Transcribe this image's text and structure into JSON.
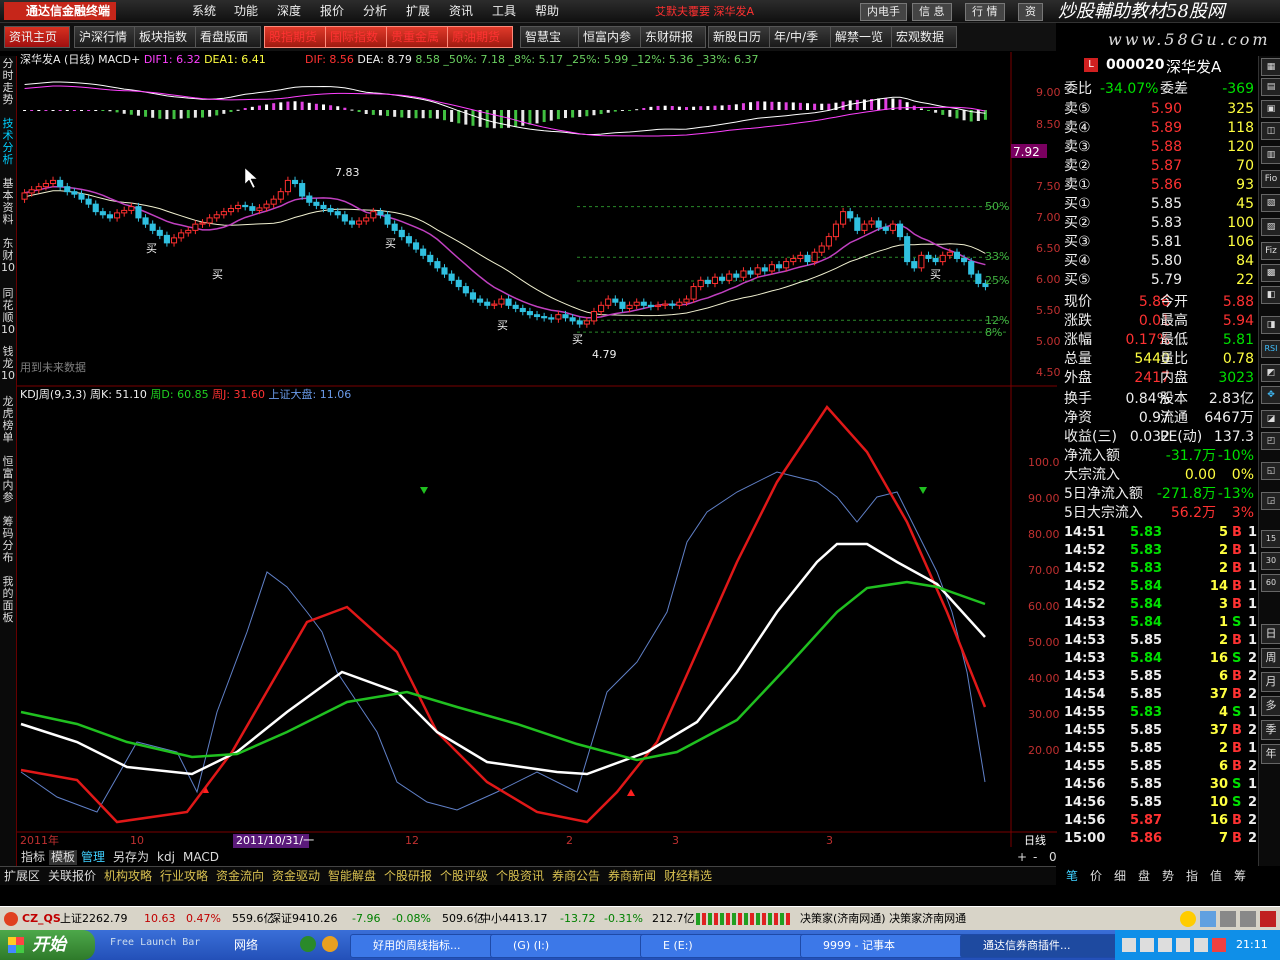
{
  "app": {
    "logo": "通达信金融终端",
    "menus": [
      "系统",
      "功能",
      "深度",
      "报价",
      "分析",
      "扩展",
      "资讯",
      "工具",
      "帮助"
    ],
    "alert": "艾默夫覆要 深华发A",
    "window_buttons": [
      "内电手",
      "信 息",
      "行 情",
      "资"
    ],
    "watermark": "炒股輔助教材58股网",
    "watermark_url": "www.58Gu.com"
  },
  "toolbar": {
    "buttons": [
      "资讯主页",
      "沪深行情",
      "板块指数",
      "看盘版面",
      "股指期货",
      "国际指数",
      "贵重金属",
      "原油期货",
      "智慧宝",
      "恒富内参",
      "东财研报",
      "新股日历",
      "年/中/季",
      "解禁一览",
      "宏观数据"
    ]
  },
  "left_tabs": [
    "分时走势",
    "技术分析",
    "基本资料",
    "东财10",
    "同花顺10",
    "钱龙10",
    "龙虎榜单",
    "恒富内参",
    "筹码分布",
    "我的面板"
  ],
  "upper_panel": {
    "stock": "深华发A",
    "period": "(日线)",
    "indicator": "MACD+",
    "dif1": "DIF1: 6.32",
    "dea1": "DEA1: 6.41",
    "dif": "DIF: 8.56",
    "dea": "DEA: 8.79",
    "pct_labels": "8.58  _50%: 7.18  _8%: 5.17  _25%: 5.99  _12%: 5.36  _33%: 6.37",
    "price_high": "7.83",
    "price_low": "4.79",
    "buy_label": "买",
    "cursor_price": "7.92",
    "y_ticks": [
      "9.00",
      "8.50",
      "8.00",
      "7.50",
      "7.00",
      "6.50",
      "6.00",
      "5.50",
      "5.00",
      "4.50"
    ],
    "fib_labels": [
      "50%",
      "33%",
      "25%",
      "12%",
      "8%"
    ],
    "note": "用到未来数据"
  },
  "lower_panel": {
    "indicator": "KDJ周(9,3,3)",
    "k": "周K: 51.10",
    "d": "周D: 60.85",
    "j": "周J: 31.60",
    "index": "上证大盘: 11.06",
    "y_ticks": [
      "100.0",
      "90.00",
      "80.00",
      "70.00",
      "60.00",
      "50.00",
      "40.00",
      "30.00",
      "20.00"
    ],
    "x_ticks": [
      "2011年",
      "10",
      "11",
      "12",
      "2",
      "3"
    ],
    "date_marker": "2011/10/31/一",
    "period_label": "日线"
  },
  "bottom_tabs": [
    "指标",
    "模板",
    "管理",
    "另存为",
    "kdj",
    "MACD"
  ],
  "quick_links": [
    "扩展区",
    "关联报价",
    "机构攻略",
    "行业攻略",
    "资金流向",
    "资金驱动",
    "智能解盘",
    "个股研报",
    "个股评级",
    "个股资讯",
    "券商公告",
    "券商新闻",
    "财经精选"
  ],
  "right_bottom_tabs": [
    "笔",
    "价",
    "细",
    "盘",
    "势",
    "指",
    "值",
    "筹"
  ],
  "quote": {
    "code": "000020",
    "name": "深华发A",
    "weibi_label": "委比",
    "weibi": "-34.07%",
    "weicha_label": "委差",
    "weicha": "-369",
    "asks": [
      {
        "label": "卖⑤",
        "price": "5.90",
        "vol": "325"
      },
      {
        "label": "卖④",
        "price": "5.89",
        "vol": "118"
      },
      {
        "label": "卖③",
        "price": "5.88",
        "vol": "120"
      },
      {
        "label": "卖②",
        "price": "5.87",
        "vol": "70"
      },
      {
        "label": "卖①",
        "price": "5.86",
        "vol": "93"
      }
    ],
    "bids": [
      {
        "label": "买①",
        "price": "5.85",
        "vol": "45"
      },
      {
        "label": "买②",
        "price": "5.83",
        "vol": "100"
      },
      {
        "label": "买③",
        "price": "5.81",
        "vol": "106"
      },
      {
        "label": "买④",
        "price": "5.80",
        "vol": "84"
      },
      {
        "label": "买⑤",
        "price": "5.79",
        "vol": "22"
      }
    ],
    "stats": [
      {
        "l1": "现价",
        "v1": "5.86",
        "l2": "今开",
        "v2": "5.88",
        "c1": "red",
        "c2": "red"
      },
      {
        "l1": "涨跌",
        "v1": "0.01",
        "l2": "最高",
        "v2": "5.94",
        "c1": "red",
        "c2": "red"
      },
      {
        "l1": "涨幅",
        "v1": "0.17%",
        "l2": "最低",
        "v2": "5.81",
        "c1": "red",
        "c2": "green"
      },
      {
        "l1": "总量",
        "v1": "5440",
        "l2": "量比",
        "v2": "0.78",
        "c1": "yellow",
        "c2": "yellow"
      },
      {
        "l1": "外盘",
        "v1": "2417",
        "l2": "内盘",
        "v2": "3023",
        "c1": "red",
        "c2": "green"
      }
    ],
    "fund": [
      {
        "l1": "换手",
        "v1": "0.84%",
        "l2": "股本",
        "v2": "2.83亿"
      },
      {
        "l1": "净资",
        "v1": "0.97",
        "l2": "流通",
        "v2": "6467万"
      },
      {
        "l1": "收益(三)",
        "v1": "0.032",
        "l2": "PE(动)",
        "v2": "137.3"
      }
    ],
    "flows": [
      {
        "label": "净流入额",
        "v": "-31.7万",
        "p": "-10%"
      },
      {
        "label": "大宗流入",
        "v": "0.00",
        "p": "0%"
      },
      {
        "label": "5日净流入额",
        "v": "-271.8万",
        "p": "-13%"
      },
      {
        "label": "5日大宗流入",
        "v": "56.2万",
        "p": "3%"
      }
    ],
    "ticks": [
      {
        "t": "14:51",
        "p": "5.83",
        "v": "5",
        "s": "B",
        "n": "1"
      },
      {
        "t": "14:52",
        "p": "5.83",
        "v": "2",
        "s": "B",
        "n": "1"
      },
      {
        "t": "14:52",
        "p": "5.83",
        "v": "2",
        "s": "B",
        "n": "1"
      },
      {
        "t": "14:52",
        "p": "5.84",
        "v": "14",
        "s": "B",
        "n": "1"
      },
      {
        "t": "14:52",
        "p": "5.84",
        "v": "3",
        "s": "B",
        "n": "1"
      },
      {
        "t": "14:53",
        "p": "5.84",
        "v": "1",
        "s": "S",
        "n": "1"
      },
      {
        "t": "14:53",
        "p": "5.85",
        "v": "2",
        "s": "B",
        "n": "1"
      },
      {
        "t": "14:53",
        "p": "5.84",
        "v": "16",
        "s": "S",
        "n": "2"
      },
      {
        "t": "14:53",
        "p": "5.85",
        "v": "6",
        "s": "B",
        "n": "2"
      },
      {
        "t": "14:54",
        "p": "5.85",
        "v": "37",
        "s": "B",
        "n": "2"
      },
      {
        "t": "14:55",
        "p": "5.83",
        "v": "4",
        "s": "S",
        "n": "1"
      },
      {
        "t": "14:55",
        "p": "5.85",
        "v": "37",
        "s": "B",
        "n": "2"
      },
      {
        "t": "14:55",
        "p": "5.85",
        "v": "2",
        "s": "B",
        "n": "1"
      },
      {
        "t": "14:55",
        "p": "5.85",
        "v": "6",
        "s": "B",
        "n": "2"
      },
      {
        "t": "14:56",
        "p": "5.85",
        "v": "30",
        "s": "S",
        "n": "1"
      },
      {
        "t": "14:56",
        "p": "5.85",
        "v": "10",
        "s": "S",
        "n": "2"
      },
      {
        "t": "14:56",
        "p": "5.87",
        "v": "16",
        "s": "B",
        "n": "2"
      },
      {
        "t": "15:00",
        "p": "5.86",
        "v": "7",
        "s": "B",
        "n": "2"
      }
    ]
  },
  "right_tabs": [
    "日",
    "周",
    "月",
    "多",
    "季",
    "年"
  ],
  "statusbar": {
    "code": "CZ_QS",
    "idx1": "上证2262.79",
    "idx1_chg": "10.63",
    "idx1_pct": "0.47%",
    "amt1": "559.6亿",
    "idx2": "深证9410.26",
    "idx2_chg": "-7.96",
    "idx2_pct": "-0.08%",
    "amt2": "509.6亿",
    "idx3": "中小4413.17",
    "idx3_chg": "-13.72",
    "idx3_pct": "-0.31%",
    "amt3": "212.7亿",
    "msg": "决策家(济南网通) 决策家济南网通"
  },
  "taskbar": {
    "start": "开始",
    "launch": "Free Launch Bar",
    "net": "网络",
    "tasks": [
      "好用的周线指标...",
      "(G) (I:)",
      "E (E:)",
      "9999 - 记事本",
      "通达信券商插件..."
    ],
    "clock": "21:11"
  }
}
